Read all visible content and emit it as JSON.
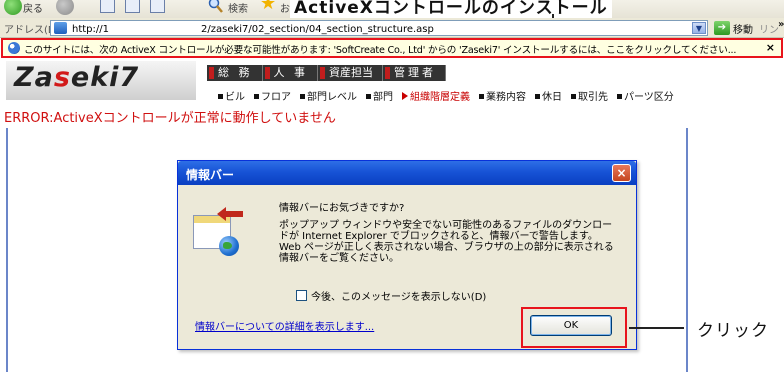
{
  "toolbar": {
    "back_label": "戻る",
    "search_label": "検索",
    "favorites_label": "お気に入り"
  },
  "overlay_caption": "ActiveXコントロールのインストール",
  "address_bar": {
    "label": "アドレス(D)",
    "url_prefix": "http://1",
    "url_suffix": "2/zaseki7/02_section/04_section_structure.asp",
    "go_label": "移動",
    "links_label": "リンク",
    "more_chevron": "»"
  },
  "infobar": {
    "message": "このサイトには、次の ActiveX コントロールが必要な可能性があります: 'SoftCreate Co., Ltd' からの 'Zaseki7' インストールするには、ここをクリックしてください...",
    "close": "×"
  },
  "site": {
    "logo": {
      "part1": "Za",
      "part2": "s",
      "part3": "eki7"
    },
    "nav_main": [
      "総 務",
      "人 事",
      "資産担当",
      "管理者"
    ],
    "nav_sub": [
      "ビル",
      "フロア",
      "部門レベル",
      "部門",
      "組織階層定義",
      "業務内容",
      "休日",
      "取引先",
      "パーツ区分"
    ],
    "nav_sub_active_index": 4,
    "error_message": "ERROR:ActiveXコントロールが正常に動作していません"
  },
  "dialog": {
    "title": "情報バー",
    "close": "×",
    "question": "情報バーにお気づきですか?",
    "description": "ポップアップ ウィンドウや安全でない可能性のあるファイルのダウンロードが Internet Explorer でブロックされると、情報バーで警告します。Web ページが正しく表示されない場合、ブラウザの上の部分に表示される情報バーをご覧ください。",
    "checkbox_label": "今後、このメッセージを表示しない(D)",
    "checkbox_checked": false,
    "link": "情報バーについての詳細を表示します...",
    "ok_label": "OK"
  },
  "callout": {
    "label": "クリック"
  },
  "colors": {
    "highlight_red": "#e8141c",
    "xp_title_blue": "#0a3fc1",
    "error_red": "#d01010",
    "infobar_yellow": "#ffffe1"
  }
}
